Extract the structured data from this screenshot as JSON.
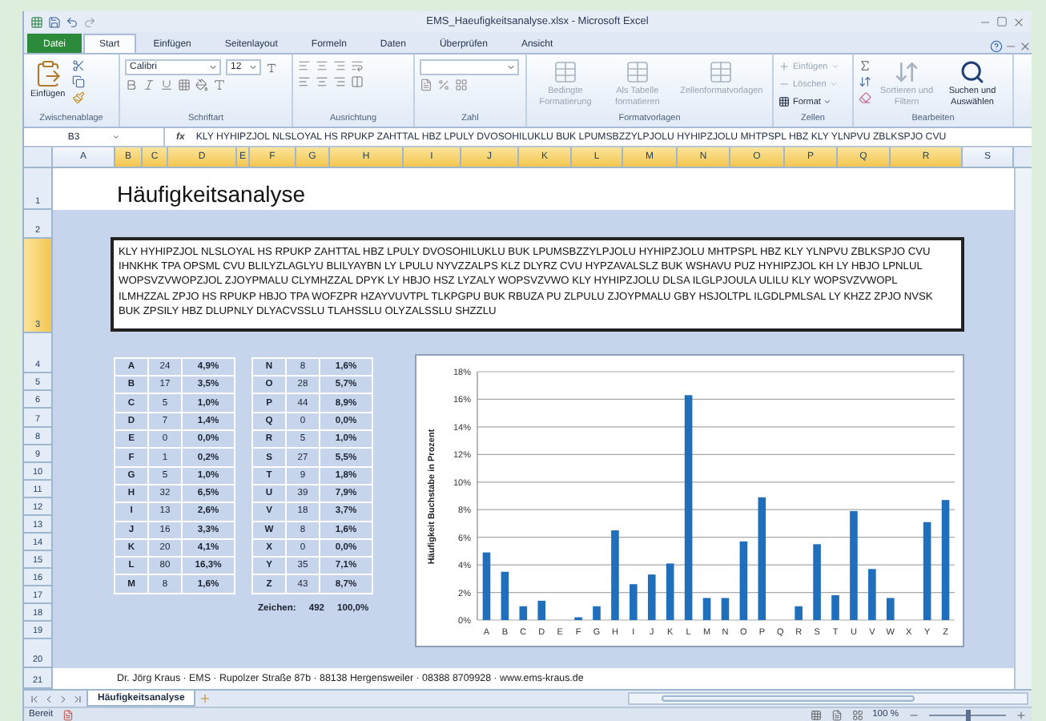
{
  "window": {
    "title": "EMS_Haeufigkeitsanalyse.xlsx - Microsoft Excel"
  },
  "ribbon_tabs": [
    {
      "label": "Datei",
      "kind": "file",
      "selected": false
    },
    {
      "label": "Start",
      "kind": "tab",
      "selected": true
    },
    {
      "label": "Einfügen",
      "kind": "tab",
      "selected": false
    },
    {
      "label": "Seitenlayout",
      "kind": "tab",
      "selected": false
    },
    {
      "label": "Formeln",
      "kind": "tab",
      "selected": false
    },
    {
      "label": "Daten",
      "kind": "tab",
      "selected": false
    },
    {
      "label": "Überprüfen",
      "kind": "tab",
      "selected": false
    },
    {
      "label": "Ansicht",
      "kind": "tab",
      "selected": false
    }
  ],
  "ribbon_groups": [
    {
      "kind": "clipboard",
      "label": "Zwischenablage",
      "buttons": [
        {
          "label": "Einfügen",
          "disabled": false
        }
      ]
    },
    {
      "kind": "font",
      "label": "Schriftart",
      "font": "Calibri",
      "size": "12"
    },
    {
      "kind": "alignment",
      "label": "Ausrichtung"
    },
    {
      "kind": "number",
      "label": "Zahl"
    },
    {
      "kind": "styles",
      "label": "Formatvorlagen",
      "buttons": [
        {
          "label": "Bedingte Formatierung",
          "disabled": true
        },
        {
          "label": "Als Tabelle formatieren",
          "disabled": true
        },
        {
          "label": "Zellenformatvorlagen",
          "disabled": true
        }
      ]
    },
    {
      "kind": "cells",
      "label": "Zellen",
      "buttons": [
        {
          "label": "Einfügen",
          "disabled": true
        },
        {
          "label": "Löschen",
          "disabled": true
        },
        {
          "label": "Format",
          "disabled": false
        }
      ]
    },
    {
      "kind": "editing",
      "label": "Bearbeiten",
      "buttons": [
        {
          "label": "Sortieren und Filtern",
          "disabled": true
        },
        {
          "label": "Suchen und Auswählen",
          "disabled": false
        }
      ]
    }
  ],
  "formula_bar": {
    "name_box": "B3",
    "fx_label": "fx",
    "formula": "KLY HYHIPZJOL NLSLOYAL HS RPUKP ZAHTTAL HBZ LPULY DVOSOHILUKLU BUK LPUMSBZZYLPJOLU HYHIPZJOLU MHTPSPL HBZ KLY YLNPVU ZBLKSPJO CVU"
  },
  "columns": [
    {
      "label": "A",
      "selected": false
    },
    {
      "label": "B",
      "selected": true
    },
    {
      "label": "C",
      "selected": true
    },
    {
      "label": "D",
      "selected": true
    },
    {
      "label": "E",
      "selected": true
    },
    {
      "label": "F",
      "selected": true
    },
    {
      "label": "G",
      "selected": true
    },
    {
      "label": "H",
      "selected": true
    },
    {
      "label": "I",
      "selected": true
    },
    {
      "label": "J",
      "selected": true
    },
    {
      "label": "K",
      "selected": true
    },
    {
      "label": "L",
      "selected": true
    },
    {
      "label": "M",
      "selected": true
    },
    {
      "label": "N",
      "selected": true
    },
    {
      "label": "O",
      "selected": true
    },
    {
      "label": "P",
      "selected": true
    },
    {
      "label": "Q",
      "selected": true
    },
    {
      "label": "R",
      "selected": true
    },
    {
      "label": "S",
      "selected": false
    }
  ],
  "rows": [
    {
      "label": "1",
      "selected": false
    },
    {
      "label": "2",
      "selected": false
    },
    {
      "label": "3",
      "selected": true
    },
    {
      "label": "4",
      "selected": false
    },
    {
      "label": "5",
      "selected": false
    },
    {
      "label": "6",
      "selected": false
    },
    {
      "label": "7",
      "selected": false
    },
    {
      "label": "8",
      "selected": false
    },
    {
      "label": "9",
      "selected": false
    },
    {
      "label": "10",
      "selected": false
    },
    {
      "label": "11",
      "selected": false
    },
    {
      "label": "12",
      "selected": false
    },
    {
      "label": "13",
      "selected": false
    },
    {
      "label": "14",
      "selected": false
    },
    {
      "label": "15",
      "selected": false
    },
    {
      "label": "16",
      "selected": false
    },
    {
      "label": "17",
      "selected": false
    },
    {
      "label": "18",
      "selected": false
    },
    {
      "label": "19",
      "selected": false
    },
    {
      "label": "20",
      "selected": false
    },
    {
      "label": "21",
      "selected": false
    }
  ],
  "sheet": {
    "title": "Häufigkeitsanalyse",
    "text_lines": [
      "KLY HYHIPZJOL NLSLOYAL HS RPUKP ZAHTTAL HBZ LPULY DVOSOHILUKLU BUK LPUMSBZZYLPJOLU HYHIPZJOLU MHTPSPL HBZ KLY YLNPVU ZBLKSPJO CVU",
      "IHNKHK TPA OPSML CVU BLILYZLAGLYU BLILYAYBN LY LPULU NYVZZALPS KLZ DLYRZ CVU HYPZAVALSLZ BUK WSHAVU PUZ HYHIPZJOL KH LY HBJO LPNLUL",
      "WOPSVZVWOPZJOL ZJOYPMALU CLYMHZZAL DPYK LY HBJO HSZ LYZALY WOPSVZVWO KLY HYHIPZJOLU DLSA ILGLPJOULA ULILU KLY WOPSVZVWOPL",
      "ILMHZZAL ZPJO HS RPUKP HBJO TPA WOFZPR HZAYVUVTPL TLKPGPU BUK RBUZA PU ZLPULU ZJOYPMALU GBY HSJOLTPL ILGDLPMLSAL LY KHZZ ZPJO NVSK",
      "BUK ZPSILY HBZ DLUPNLY DLYACVSSLU TLAHSSLU OLYZALSSLU SHZZLU"
    ],
    "tables": [
      [
        [
          "A",
          "24",
          "4,9%"
        ],
        [
          "B",
          "17",
          "3,5%"
        ],
        [
          "C",
          "5",
          "1,0%"
        ],
        [
          "D",
          "7",
          "1,4%"
        ],
        [
          "E",
          "0",
          "0,0%"
        ],
        [
          "F",
          "1",
          "0,2%"
        ],
        [
          "G",
          "5",
          "1,0%"
        ],
        [
          "H",
          "32",
          "6,5%"
        ],
        [
          "I",
          "13",
          "2,6%"
        ],
        [
          "J",
          "16",
          "3,3%"
        ],
        [
          "K",
          "20",
          "4,1%"
        ],
        [
          "L",
          "80",
          "16,3%"
        ],
        [
          "M",
          "8",
          "1,6%"
        ]
      ],
      [
        [
          "N",
          "8",
          "1,6%"
        ],
        [
          "O",
          "28",
          "5,7%"
        ],
        [
          "P",
          "44",
          "8,9%"
        ],
        [
          "Q",
          "0",
          "0,0%"
        ],
        [
          "R",
          "5",
          "1,0%"
        ],
        [
          "S",
          "27",
          "5,5%"
        ],
        [
          "T",
          "9",
          "1,8%"
        ],
        [
          "U",
          "39",
          "7,9%"
        ],
        [
          "V",
          "18",
          "3,7%"
        ],
        [
          "W",
          "8",
          "1,6%"
        ],
        [
          "X",
          "0",
          "0,0%"
        ],
        [
          "Y",
          "35",
          "7,1%"
        ],
        [
          "Z",
          "43",
          "8,7%"
        ]
      ]
    ],
    "total": {
      "label": "Zeichen:",
      "count": "492",
      "percent": "100,0%"
    },
    "chart_data": {
      "type": "bar",
      "grid": true,
      "ylabel": "Häufigkeit Buchstabe in Prozent",
      "categories": [
        "A",
        "B",
        "C",
        "D",
        "E",
        "F",
        "G",
        "H",
        "I",
        "J",
        "K",
        "L",
        "M",
        "N",
        "O",
        "P",
        "Q",
        "R",
        "S",
        "T",
        "U",
        "V",
        "W",
        "X",
        "Y",
        "Z"
      ],
      "values": [
        4.9,
        3.5,
        1.0,
        1.4,
        0,
        0.2,
        1.0,
        6.5,
        2.6,
        3.3,
        4.1,
        16.3,
        1.6,
        1.6,
        5.7,
        8.9,
        0,
        1.0,
        5.5,
        1.8,
        7.9,
        3.7,
        1.6,
        0,
        7.1,
        8.7
      ],
      "ylim": [
        0,
        18
      ],
      "yticks": [
        {
          "value": 0,
          "label": "0%"
        },
        {
          "value": 2,
          "label": "2%"
        },
        {
          "value": 4,
          "label": "4%"
        },
        {
          "value": 6,
          "label": "6%"
        },
        {
          "value": 8,
          "label": "8%"
        },
        {
          "value": 10,
          "label": "10%"
        },
        {
          "value": 12,
          "label": "12%"
        },
        {
          "value": 14,
          "label": "14%"
        },
        {
          "value": 16,
          "label": "16%"
        },
        {
          "value": 18,
          "label": "18%"
        }
      ]
    },
    "footer": "Dr. Jörg Kraus · EMS · Rupolzer Straße 87b · 88138 Hergensweiler · 08388 8709928 · www.ems-kraus.de"
  },
  "sheet_tabs": [
    {
      "label": "Häufigkeitsanalyse",
      "selected": true
    }
  ],
  "status_bar": {
    "text": "Bereit",
    "zoom": "100 %",
    "level": 0.5
  }
}
